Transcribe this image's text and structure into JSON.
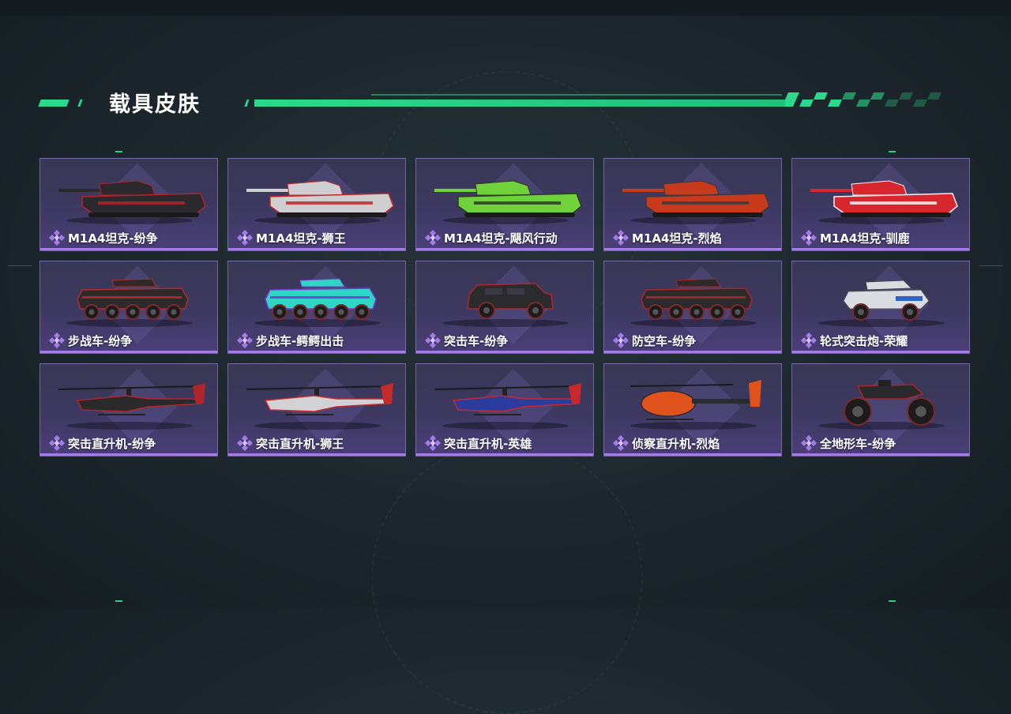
{
  "section_title": "载具皮肤",
  "accent_color": "#2bd98a",
  "rarity_color": "#a57be8",
  "rarity_icon": "purple-diamond-cluster-icon",
  "skins": [
    {
      "label": "M1A4坦克-纷争",
      "vehicle": "tank",
      "colors": [
        "#2a2a2e",
        "#b3232a"
      ]
    },
    {
      "label": "M1A4坦克-狮王",
      "vehicle": "tank",
      "colors": [
        "#cfcfd2",
        "#c02a2a"
      ]
    },
    {
      "label": "M1A4坦克-飓风行动",
      "vehicle": "tank",
      "colors": [
        "#6fd23a",
        "#2d3a22"
      ]
    },
    {
      "label": "M1A4坦克-烈焰",
      "vehicle": "tank",
      "colors": [
        "#c83a1c",
        "#3a3a3e"
      ]
    },
    {
      "label": "M1A4坦克-驯鹿",
      "vehicle": "tank",
      "colors": [
        "#d8262e",
        "#f2f2f2"
      ]
    },
    {
      "label": "步战车-纷争",
      "vehicle": "ifv",
      "colors": [
        "#2e2a2c",
        "#b52a2a"
      ]
    },
    {
      "label": "步战车-鳄鳄出击",
      "vehicle": "ifv",
      "colors": [
        "#2fd6c4",
        "#7a3ad8"
      ]
    },
    {
      "label": "突击车-纷争",
      "vehicle": "jeep",
      "colors": [
        "#2b2a2d",
        "#b0262a"
      ]
    },
    {
      "label": "防空车-纷争",
      "vehicle": "ifv",
      "colors": [
        "#2d2a2c",
        "#a8262a"
      ]
    },
    {
      "label": "轮式突击炮-荣耀",
      "vehicle": "gun",
      "colors": [
        "#d9dde2",
        "#2b63c9"
      ]
    },
    {
      "label": "突击直升机-纷争",
      "vehicle": "heli",
      "colors": [
        "#2a2a2d",
        "#b0262a"
      ]
    },
    {
      "label": "突击直升机-狮王",
      "vehicle": "heli",
      "colors": [
        "#d2d2d6",
        "#c42a2a"
      ]
    },
    {
      "label": "突击直升机-英雄",
      "vehicle": "heli",
      "colors": [
        "#2b3c9e",
        "#c8282a"
      ]
    },
    {
      "label": "侦察直升机-烈焰",
      "vehicle": "scout",
      "colors": [
        "#e0521c",
        "#2c2c30"
      ]
    },
    {
      "label": "全地形车-纷争",
      "vehicle": "atv",
      "colors": [
        "#29282b",
        "#a8262a"
      ]
    }
  ]
}
